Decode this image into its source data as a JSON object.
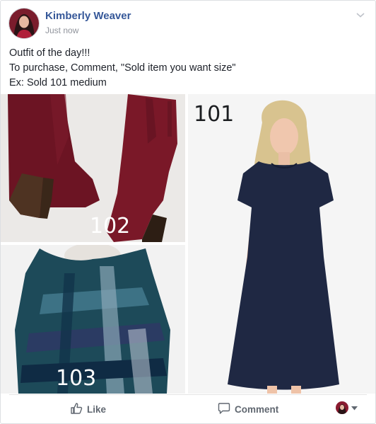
{
  "post": {
    "author": "Kimberly Weaver",
    "timestamp": "Just now",
    "text_lines": [
      "Outfit of the day!!!",
      "To purchase, Comment, \"Sold item you want size\"",
      "Ex: Sold 101 medium"
    ]
  },
  "photos": [
    {
      "number": "102",
      "subject": "burgundy suede ankle boots"
    },
    {
      "number": "103",
      "subject": "teal plaid blanket scarf"
    },
    {
      "number": "101",
      "subject": "navy short sleeve swing dress"
    }
  ],
  "actions": {
    "like": "Like",
    "comment": "Comment"
  },
  "colors": {
    "author_link": "#365899",
    "action_text": "#606770",
    "meta_text": "#90949c"
  }
}
